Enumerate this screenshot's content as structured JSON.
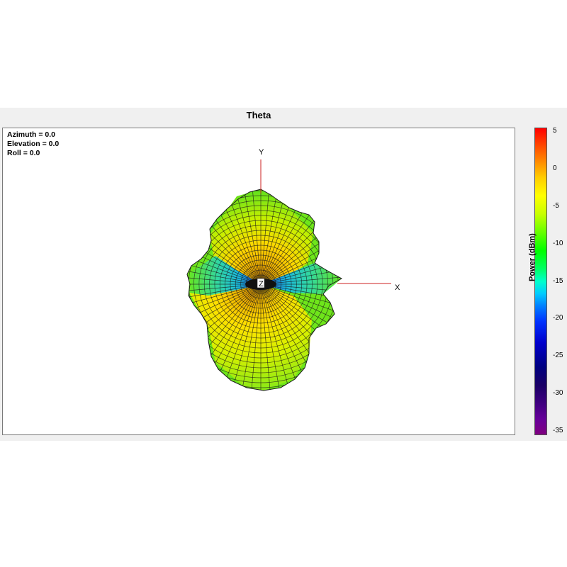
{
  "chart_data": {
    "type": "3d-radiation-pattern",
    "title": "Theta",
    "orientation": {
      "azimuth": "Azimuth = 0.0",
      "elevation": "Elevation = 0.0",
      "roll": "Roll = 0.0"
    },
    "axes": {
      "x_label": "X",
      "y_label": "Y",
      "z_label": "Z"
    },
    "colorbar": {
      "label": "Power  (dBm)",
      "ticks": [
        "5",
        "0",
        "-5",
        "-10",
        "-15",
        "-20",
        "-25",
        "-30",
        "-35"
      ],
      "range": [
        -35,
        5
      ]
    }
  }
}
